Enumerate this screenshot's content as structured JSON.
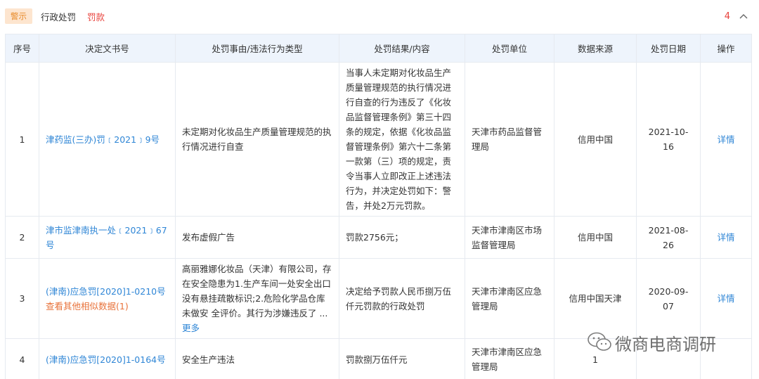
{
  "header": {
    "badge": "警示",
    "tab_admin": "行政处罚",
    "tab_fine": "罚款",
    "count": "4"
  },
  "table": {
    "columns": [
      "序号",
      "决定文书号",
      "处罚事由/违法行为类型",
      "处罚结果/内容",
      "处罚单位",
      "数据来源",
      "处罚日期",
      "操作"
    ],
    "rows": [
      {
        "index": "1",
        "doc_no": "津药监(三办)罚﹝2021﹞9号",
        "reason": "未定期对化妆品生产质量管理规范的执行情况进行自查",
        "result": "当事人未定期对化妆品生产质量管理规范的执行情况进行自查的行为违反了《化妆品监督管理条例》第三十四条的规定，依据《化妆品监督管理条例》第六十二条第一款第（三）项的规定，责令当事人立即改正上述违法行为，并决定处罚如下：警告，并处2万元罚款。",
        "unit": "天津市药品监督管理局",
        "source": "信用中国",
        "date": "2021-10-16",
        "action": "详情"
      },
      {
        "index": "2",
        "doc_no": "津市监津南执一处﹝2021﹞67号",
        "reason": "发布虚假广告",
        "result": "罚款2756元；",
        "unit": "天津市津南区市场监督管理局",
        "source": "信用中国",
        "date": "2021-08-26",
        "action": "详情"
      },
      {
        "index": "3",
        "doc_no": "(津南)应急罚[2020]1-0210号",
        "similar": "查看其他相似数据(1)",
        "reason": "高丽雅娜化妆品（天津）有限公司，存在安全隐患为1.生产车间一处安全出口没有悬挂疏散标识;2.危险化学品仓库未做安 全评价。其行为涉嫌违反了 ...",
        "more": "更多",
        "result": "决定给予罚款人民币捌万伍仟元罚款的行政处罚",
        "unit": "天津市津南区应急管理局",
        "source": "信用中国天津",
        "date": "2020-09-07",
        "action": "详情"
      },
      {
        "index": "4",
        "doc_no": "(津南)应急罚[2020]1-0164号",
        "reason": "安全生产违法",
        "result": "罚款捌万伍仟元",
        "unit": "天津市津南区应急管理局",
        "source": "1",
        "date": "",
        "action": ""
      }
    ]
  },
  "watermark": {
    "text": "微商电商调研",
    "icon": "wechat-icon"
  }
}
